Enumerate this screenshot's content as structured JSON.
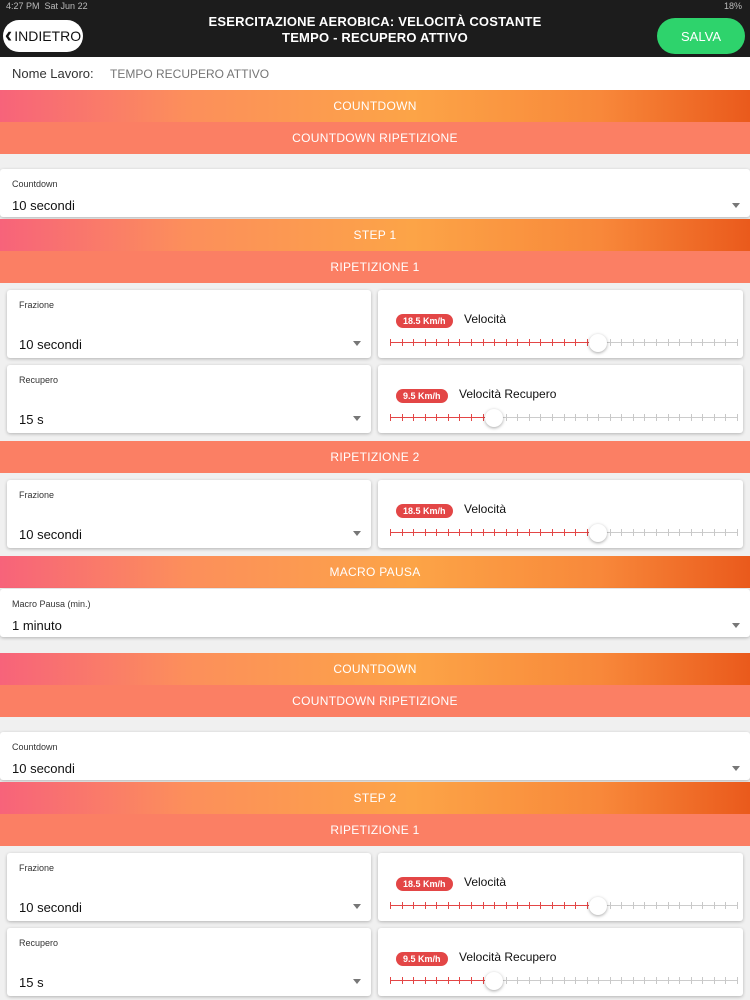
{
  "status": {
    "time": "4:27 PM",
    "date": "Sat Jun 22",
    "battery": "18%"
  },
  "nav": {
    "back_label": "INDIETRO",
    "title_line1": "ESERCITAZIONE AEROBICA: VELOCITÀ COSTANTE",
    "title_line2": "TEMPO - RECUPERO ATTIVO",
    "save_label": "SALVA"
  },
  "name": {
    "label": "Nome Lavoro:",
    "value": "TEMPO RECUPERO ATTIVO"
  },
  "bands": {
    "countdown": "COUNTDOWN",
    "countdown_rip": "COUNTDOWN RIPETIZIONE",
    "step1": "STEP 1",
    "rip1": "RIPETIZIONE 1",
    "rip2": "RIPETIZIONE 2",
    "macro": "MACRO PAUSA",
    "countdown2": "COUNTDOWN",
    "countdown_rip2": "COUNTDOWN RIPETIZIONE",
    "step2": "STEP 2",
    "rip1b": "RIPETIZIONE 1"
  },
  "countdown1": {
    "caption": "Countdown",
    "value": "10 secondi"
  },
  "macro_sel": {
    "caption": "Macro Pausa (min.)",
    "value": "1 minuto"
  },
  "countdown2": {
    "caption": "Countdown",
    "value": "10 secondi"
  },
  "s1r1": {
    "frazione": {
      "caption": "Frazione",
      "value": "10 secondi"
    },
    "recupero": {
      "caption": "Recupero",
      "value": "15 s"
    },
    "velocita": {
      "badge": "18.5 Km/h",
      "label": "Velocità",
      "level": 0.6
    },
    "vel_recupero": {
      "badge": "9.5 Km/h",
      "label": "Velocità Recupero",
      "level": 0.3
    }
  },
  "s1r2": {
    "frazione": {
      "caption": "Frazione",
      "value": "10 secondi"
    },
    "velocita": {
      "badge": "18.5 Km/h",
      "label": "Velocità",
      "level": 0.6
    }
  },
  "s2r1": {
    "frazione": {
      "caption": "Frazione",
      "value": "10 secondi"
    },
    "recupero": {
      "caption": "Recupero",
      "value": "15 s"
    },
    "velocita": {
      "badge": "18.5 Km/h",
      "label": "Velocità",
      "level": 0.6
    },
    "vel_recupero": {
      "badge": "9.5 Km/h",
      "label": "Velocità Recupero",
      "level": 0.3
    }
  },
  "colors": {
    "accent": "#e34646",
    "save": "#2ed36c",
    "band": "#fb7f64"
  }
}
